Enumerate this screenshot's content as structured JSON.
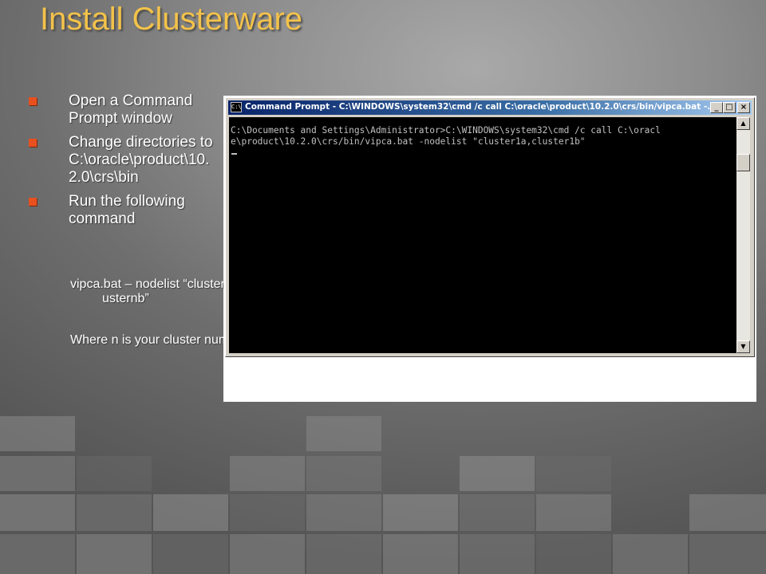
{
  "slide": {
    "title": "Install Clusterware",
    "bullets": [
      {
        "text": "Open a Command Prompt window"
      },
      {
        "text": "Change directories to C:\\oracle\\product\\10.2.0\\crs\\bin"
      },
      {
        "text": "Run the following command"
      }
    ],
    "sub_items": [
      {
        "text": "vipca.bat – nodelist “clusterna,clusternb”"
      },
      {
        "text": "Where n is your cluster number"
      }
    ]
  },
  "window": {
    "icon_label": "C:\\",
    "title": "Command Prompt - C:\\WINDOWS\\system32\\cmd /c call C:\\oracle\\product\\10.2.0\\crs/bin/vipca.bat -...",
    "minimize_label": "_",
    "maximize_label": "□",
    "close_label": "×",
    "console_lines": [
      "C:\\Documents and Settings\\Administrator>C:\\WINDOWS\\system32\\cmd /c call C:\\oracl",
      "e\\product\\10.2.0\\crs/bin/vipca.bat -nodelist \"cluster1a,cluster1b\""
    ],
    "scroll_up_icon": "▲",
    "scroll_down_icon": "▼"
  },
  "colors": {
    "title": "#f3c24a",
    "bullet_marker": "#e8501e",
    "titlebar_start": "#0a246a",
    "console_bg": "#000000",
    "console_text": "#c0c0c0"
  }
}
